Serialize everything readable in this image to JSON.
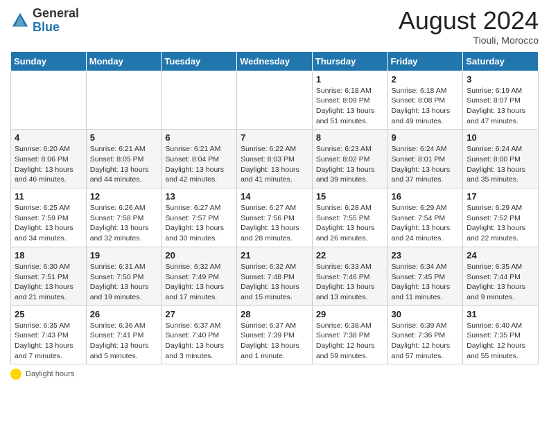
{
  "logo": {
    "general": "General",
    "blue": "Blue"
  },
  "title": {
    "month_year": "August 2024",
    "location": "Tiouli, Morocco"
  },
  "days_of_week": [
    "Sunday",
    "Monday",
    "Tuesday",
    "Wednesday",
    "Thursday",
    "Friday",
    "Saturday"
  ],
  "footer": {
    "daylight_label": "Daylight hours"
  },
  "weeks": [
    [
      {
        "day": "",
        "info": ""
      },
      {
        "day": "",
        "info": ""
      },
      {
        "day": "",
        "info": ""
      },
      {
        "day": "",
        "info": ""
      },
      {
        "day": "1",
        "info": "Sunrise: 6:18 AM\nSunset: 8:09 PM\nDaylight: 13 hours and 51 minutes."
      },
      {
        "day": "2",
        "info": "Sunrise: 6:18 AM\nSunset: 8:08 PM\nDaylight: 13 hours and 49 minutes."
      },
      {
        "day": "3",
        "info": "Sunrise: 6:19 AM\nSunset: 8:07 PM\nDaylight: 13 hours and 47 minutes."
      }
    ],
    [
      {
        "day": "4",
        "info": "Sunrise: 6:20 AM\nSunset: 8:06 PM\nDaylight: 13 hours and 46 minutes."
      },
      {
        "day": "5",
        "info": "Sunrise: 6:21 AM\nSunset: 8:05 PM\nDaylight: 13 hours and 44 minutes."
      },
      {
        "day": "6",
        "info": "Sunrise: 6:21 AM\nSunset: 8:04 PM\nDaylight: 13 hours and 42 minutes."
      },
      {
        "day": "7",
        "info": "Sunrise: 6:22 AM\nSunset: 8:03 PM\nDaylight: 13 hours and 41 minutes."
      },
      {
        "day": "8",
        "info": "Sunrise: 6:23 AM\nSunset: 8:02 PM\nDaylight: 13 hours and 39 minutes."
      },
      {
        "day": "9",
        "info": "Sunrise: 6:24 AM\nSunset: 8:01 PM\nDaylight: 13 hours and 37 minutes."
      },
      {
        "day": "10",
        "info": "Sunrise: 6:24 AM\nSunset: 8:00 PM\nDaylight: 13 hours and 35 minutes."
      }
    ],
    [
      {
        "day": "11",
        "info": "Sunrise: 6:25 AM\nSunset: 7:59 PM\nDaylight: 13 hours and 34 minutes."
      },
      {
        "day": "12",
        "info": "Sunrise: 6:26 AM\nSunset: 7:58 PM\nDaylight: 13 hours and 32 minutes."
      },
      {
        "day": "13",
        "info": "Sunrise: 6:27 AM\nSunset: 7:57 PM\nDaylight: 13 hours and 30 minutes."
      },
      {
        "day": "14",
        "info": "Sunrise: 6:27 AM\nSunset: 7:56 PM\nDaylight: 13 hours and 28 minutes."
      },
      {
        "day": "15",
        "info": "Sunrise: 6:28 AM\nSunset: 7:55 PM\nDaylight: 13 hours and 26 minutes."
      },
      {
        "day": "16",
        "info": "Sunrise: 6:29 AM\nSunset: 7:54 PM\nDaylight: 13 hours and 24 minutes."
      },
      {
        "day": "17",
        "info": "Sunrise: 6:29 AM\nSunset: 7:52 PM\nDaylight: 13 hours and 22 minutes."
      }
    ],
    [
      {
        "day": "18",
        "info": "Sunrise: 6:30 AM\nSunset: 7:51 PM\nDaylight: 13 hours and 21 minutes."
      },
      {
        "day": "19",
        "info": "Sunrise: 6:31 AM\nSunset: 7:50 PM\nDaylight: 13 hours and 19 minutes."
      },
      {
        "day": "20",
        "info": "Sunrise: 6:32 AM\nSunset: 7:49 PM\nDaylight: 13 hours and 17 minutes."
      },
      {
        "day": "21",
        "info": "Sunrise: 6:32 AM\nSunset: 7:48 PM\nDaylight: 13 hours and 15 minutes."
      },
      {
        "day": "22",
        "info": "Sunrise: 6:33 AM\nSunset: 7:46 PM\nDaylight: 13 hours and 13 minutes."
      },
      {
        "day": "23",
        "info": "Sunrise: 6:34 AM\nSunset: 7:45 PM\nDaylight: 13 hours and 11 minutes."
      },
      {
        "day": "24",
        "info": "Sunrise: 6:35 AM\nSunset: 7:44 PM\nDaylight: 13 hours and 9 minutes."
      }
    ],
    [
      {
        "day": "25",
        "info": "Sunrise: 6:35 AM\nSunset: 7:43 PM\nDaylight: 13 hours and 7 minutes."
      },
      {
        "day": "26",
        "info": "Sunrise: 6:36 AM\nSunset: 7:41 PM\nDaylight: 13 hours and 5 minutes."
      },
      {
        "day": "27",
        "info": "Sunrise: 6:37 AM\nSunset: 7:40 PM\nDaylight: 13 hours and 3 minutes."
      },
      {
        "day": "28",
        "info": "Sunrise: 6:37 AM\nSunset: 7:39 PM\nDaylight: 13 hours and 1 minute."
      },
      {
        "day": "29",
        "info": "Sunrise: 6:38 AM\nSunset: 7:38 PM\nDaylight: 12 hours and 59 minutes."
      },
      {
        "day": "30",
        "info": "Sunrise: 6:39 AM\nSunset: 7:36 PM\nDaylight: 12 hours and 57 minutes."
      },
      {
        "day": "31",
        "info": "Sunrise: 6:40 AM\nSunset: 7:35 PM\nDaylight: 12 hours and 55 minutes."
      }
    ]
  ]
}
